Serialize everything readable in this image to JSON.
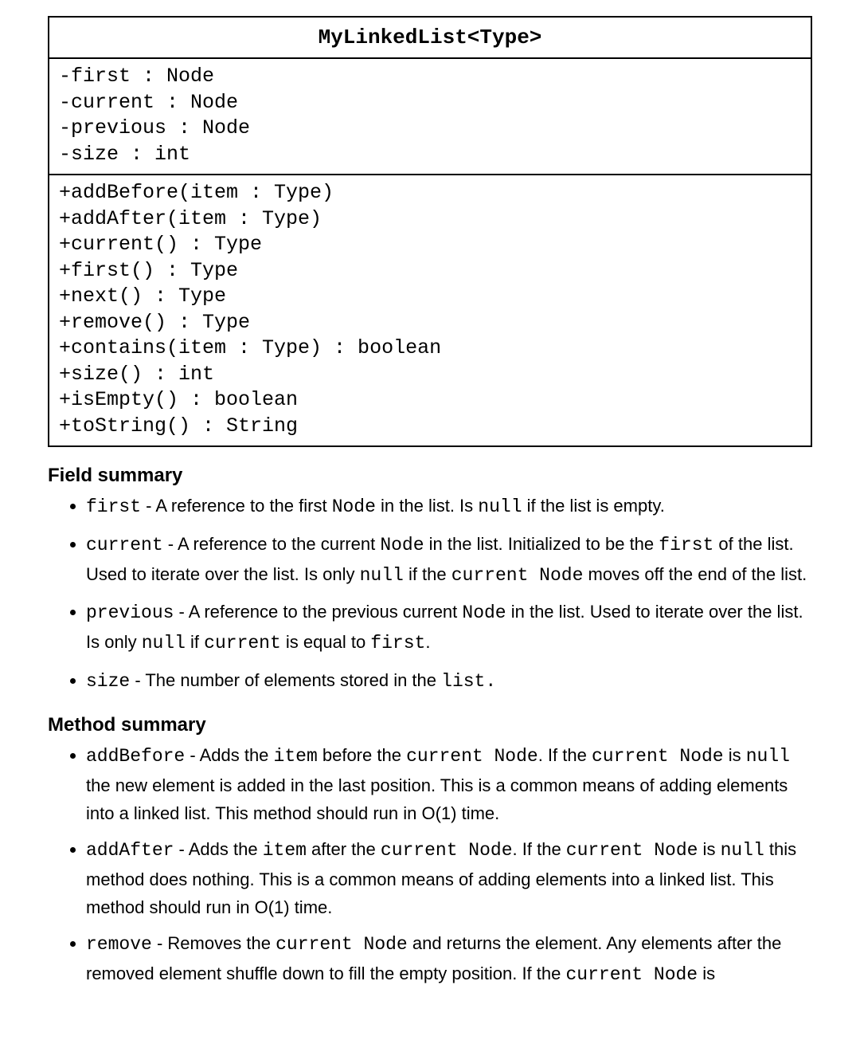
{
  "uml": {
    "title": "MyLinkedList<Type>",
    "fields": [
      "-first : Node",
      "-current : Node",
      "-previous : Node",
      "-size : int"
    ],
    "methods": [
      "+addBefore(item : Type)",
      "+addAfter(item : Type)",
      "+current() : Type",
      "+first() : Type",
      "+next() : Type",
      "+remove() : Type",
      "+contains(item : Type) : boolean",
      "+size() : int",
      "+isEmpty() : boolean",
      "+toString() : String"
    ]
  },
  "fieldSummary": {
    "heading": "Field summary",
    "items": [
      {
        "parts": [
          {
            "t": "mono",
            "v": "first"
          },
          {
            "t": "plain",
            "v": " - A reference to the first "
          },
          {
            "t": "mono",
            "v": "Node"
          },
          {
            "t": "plain",
            "v": " in the list. Is "
          },
          {
            "t": "mono",
            "v": "null"
          },
          {
            "t": "plain",
            "v": " if the list is empty."
          }
        ]
      },
      {
        "parts": [
          {
            "t": "mono",
            "v": "current"
          },
          {
            "t": "plain",
            "v": " - A reference to the current "
          },
          {
            "t": "mono",
            "v": "Node"
          },
          {
            "t": "plain",
            "v": " in the list. Initialized to be the "
          },
          {
            "t": "mono",
            "v": "first"
          },
          {
            "t": "plain",
            "v": " of the list. Used to iterate over the list. Is only "
          },
          {
            "t": "mono",
            "v": "null"
          },
          {
            "t": "plain",
            "v": " if the "
          },
          {
            "t": "mono",
            "v": "current Node"
          },
          {
            "t": "plain",
            "v": " moves off the end of the list."
          }
        ]
      },
      {
        "parts": [
          {
            "t": "mono",
            "v": "previous"
          },
          {
            "t": "plain",
            "v": " - A reference to the previous current "
          },
          {
            "t": "mono",
            "v": "Node"
          },
          {
            "t": "plain",
            "v": " in the list. Used to iterate over the list. Is only "
          },
          {
            "t": "mono",
            "v": "null"
          },
          {
            "t": "plain",
            "v": " if "
          },
          {
            "t": "mono",
            "v": "current"
          },
          {
            "t": "plain",
            "v": " is equal to "
          },
          {
            "t": "mono",
            "v": "first"
          },
          {
            "t": "plain",
            "v": "."
          }
        ]
      },
      {
        "parts": [
          {
            "t": "mono",
            "v": "size"
          },
          {
            "t": "plain",
            "v": " - The number of elements stored in the "
          },
          {
            "t": "mono",
            "v": "list."
          }
        ]
      }
    ]
  },
  "methodSummary": {
    "heading": "Method summary",
    "items": [
      {
        "parts": [
          {
            "t": "mono",
            "v": "addBefore"
          },
          {
            "t": "plain",
            "v": " - Adds the "
          },
          {
            "t": "mono",
            "v": "item"
          },
          {
            "t": "plain",
            "v": " before the "
          },
          {
            "t": "mono",
            "v": "current Node"
          },
          {
            "t": "plain",
            "v": ". If the "
          },
          {
            "t": "mono",
            "v": "current Node"
          },
          {
            "t": "plain",
            "v": " is "
          },
          {
            "t": "mono",
            "v": "null"
          },
          {
            "t": "plain",
            "v": " the new element is added in the last position. This is a common means of adding elements into a linked list. This method should run in O(1) time."
          }
        ]
      },
      {
        "parts": [
          {
            "t": "mono",
            "v": "addAfter"
          },
          {
            "t": "plain",
            "v": " - Adds the "
          },
          {
            "t": "mono",
            "v": "item"
          },
          {
            "t": "plain",
            "v": " after the "
          },
          {
            "t": "mono",
            "v": "current Node"
          },
          {
            "t": "plain",
            "v": ". If the "
          },
          {
            "t": "mono",
            "v": "current Node"
          },
          {
            "t": "plain",
            "v": " is "
          },
          {
            "t": "mono",
            "v": "null"
          },
          {
            "t": "plain",
            "v": " this method does nothing. This is a common means of adding elements into a linked list. This method should run in O(1) time."
          }
        ]
      },
      {
        "parts": [
          {
            "t": "mono",
            "v": "remove"
          },
          {
            "t": "plain",
            "v": " - Removes the "
          },
          {
            "t": "mono",
            "v": "current Node"
          },
          {
            "t": "plain",
            "v": " and returns the element. Any elements after the removed element shuffle down to fill the empty position. If the "
          },
          {
            "t": "mono",
            "v": "current Node"
          },
          {
            "t": "plain",
            "v": " is"
          }
        ]
      }
    ]
  }
}
